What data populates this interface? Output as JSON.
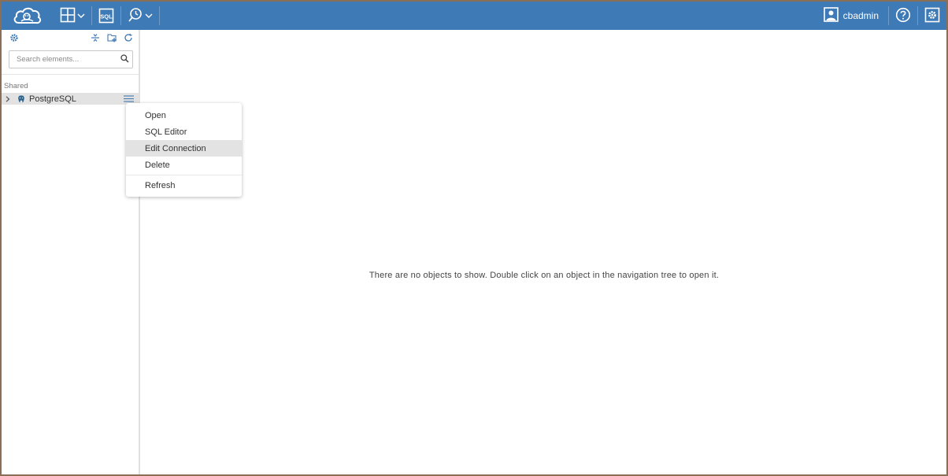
{
  "topbar": {
    "logo_icon": "cloudbeaver-logo-icon",
    "new_connection_icon": "add-connection-icon",
    "sql_icon_label": "SQL",
    "tasks_icon": "tasks-icon",
    "user_name": "cbadmin",
    "help_icon": "help-icon",
    "settings_icon": "settings-icon",
    "accent": "#3e7ab6"
  },
  "sidebar": {
    "search_placeholder": "Search elements...",
    "section_label": "Shared",
    "nodes": [
      {
        "label": "PostgreSQL",
        "icon": "postgresql-icon"
      }
    ]
  },
  "context_menu": {
    "items": [
      "Open",
      "SQL Editor",
      "Edit Connection",
      "Delete"
    ],
    "after_separator": [
      "Refresh"
    ],
    "active_item": "Edit Connection"
  },
  "main": {
    "empty_message": "There are no objects to show. Double click on an object in the navigation tree to open it."
  }
}
